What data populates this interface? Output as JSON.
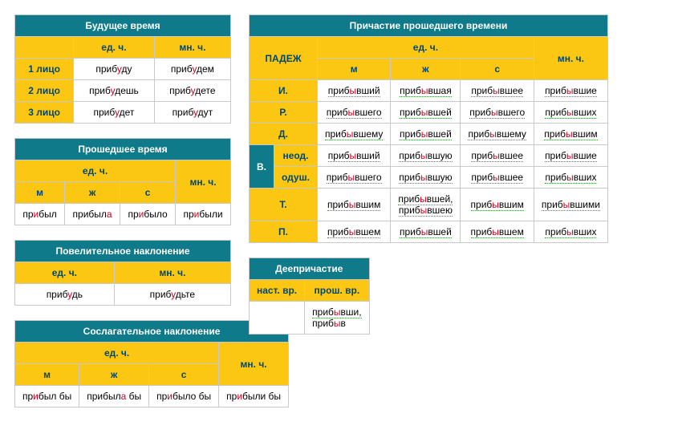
{
  "future": {
    "title": "Будущее время",
    "sg": "ед. ч.",
    "pl": "мн. ч.",
    "r1": "1 лицо",
    "r2": "2 лицо",
    "r3": "3 лицо",
    "c": {
      "1s": [
        "приб",
        "у",
        "ду"
      ],
      "1p": [
        "приб",
        "у",
        "дем"
      ],
      "2s": [
        "приб",
        "у",
        "дешь"
      ],
      "2p": [
        "приб",
        "у",
        "дете"
      ],
      "3s": [
        "приб",
        "у",
        "дет"
      ],
      "3p": [
        "приб",
        "у",
        "дут"
      ]
    }
  },
  "past": {
    "title": "Прошедшее время",
    "sg": "ед. ч.",
    "pl": "мн. ч.",
    "m": "м",
    "f": "ж",
    "n": "с",
    "c": {
      "m": [
        "пр",
        "и",
        "был"
      ],
      "f": [
        "прибыл",
        "а",
        ""
      ],
      "n": [
        "пр",
        "и",
        "было"
      ],
      "p": [
        "пр",
        "и",
        "были"
      ]
    }
  },
  "imp": {
    "title": "Повелительное наклонение",
    "sg": "ед. ч.",
    "pl": "мн. ч.",
    "c": {
      "s": [
        "приб",
        "у",
        "дь"
      ],
      "p": [
        "приб",
        "у",
        "дьте"
      ]
    }
  },
  "subj": {
    "title": "Сослагательное наклонение",
    "sg": "ед. ч.",
    "pl": "мн. ч.",
    "m": "м",
    "f": "ж",
    "n": "с",
    "c": {
      "m": [
        "пр",
        "и",
        "был бы"
      ],
      "f": [
        "прибыл",
        "а",
        " бы"
      ],
      "n": [
        "пр",
        "и",
        "было бы"
      ],
      "p": [
        "пр",
        "и",
        "были бы"
      ]
    }
  },
  "part": {
    "title": "Причастие прошедшего времени",
    "case": "ПАДЕЖ",
    "sg": "ед. ч.",
    "pl": "мн. ч.",
    "m": "м",
    "f": "ж",
    "n": "с",
    "cases": {
      "i": "И.",
      "r": "Р.",
      "d": "Д.",
      "v": "В.",
      "neod": "неод.",
      "odush": "одуш.",
      "t": "Т.",
      "p": "П."
    },
    "rows": {
      "i": {
        "m": "вший",
        "f": "вшая",
        "n": "вшее",
        "p": "вшие"
      },
      "r": {
        "m": "вшего",
        "f": "вшей",
        "n": "вшего",
        "p": "вших"
      },
      "d": {
        "m": "вшему",
        "f": "вшей",
        "n": "вшему",
        "p": "вшим"
      },
      "v_n": {
        "m": "вший",
        "f": "вшую",
        "n": "вшее",
        "p": "вшие"
      },
      "v_o": {
        "m": "вшего",
        "f": "вшую",
        "n": "вшее",
        "p": "вших"
      },
      "t": {
        "m": "вшим",
        "f": "вшей,",
        "f2": "вшею",
        "n": "вшим",
        "p": "вшими"
      },
      "p": {
        "m": "вшем",
        "f": "вшей",
        "n": "вшем",
        "p": "вших"
      }
    },
    "stem": "приб",
    "stress": "ы"
  },
  "ger": {
    "title": "Деепричастие",
    "pres": "наст. вр.",
    "past": "прош. вр.",
    "c": {
      "1": [
        "приб",
        "ы",
        "вши,"
      ],
      "2": [
        "приб",
        "ы",
        "в"
      ]
    }
  }
}
